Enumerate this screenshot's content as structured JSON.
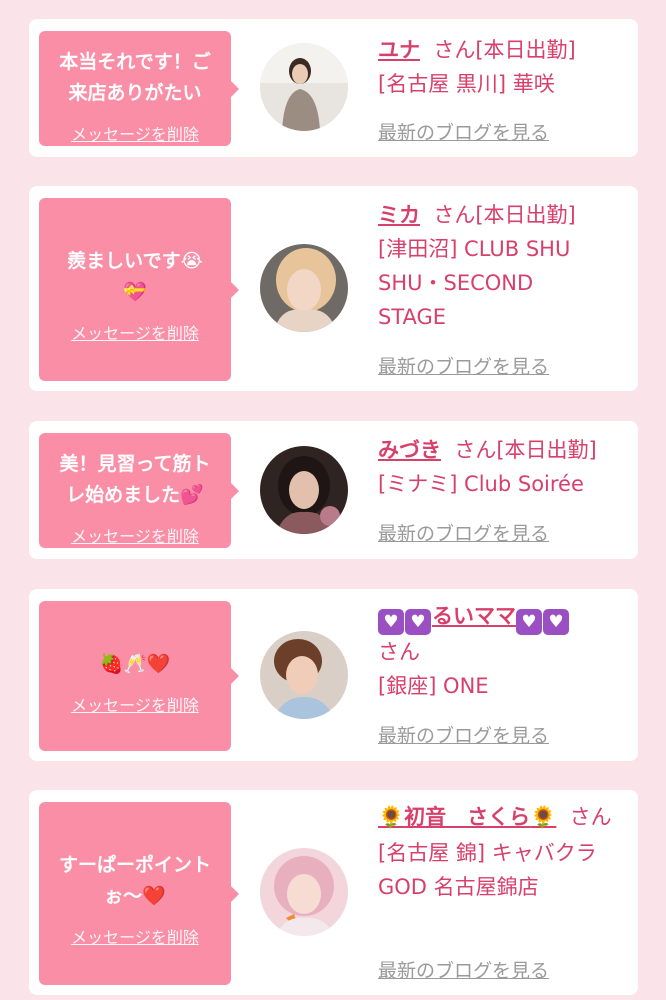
{
  "cards": [
    {
      "message": "本当それです！ご\n来店ありがたい",
      "delete_label": "メッセージを削除",
      "name": "ユナ",
      "honorific": "さん",
      "status": "[本日出勤]",
      "shop": "[名古屋 黒川] 華咲",
      "blog_label": "最新のブログを見る"
    },
    {
      "message": "羨ましいです😭\n💝",
      "delete_label": "メッセージを削除",
      "name": "ミカ",
      "honorific": "さん",
      "status": "[本日出勤]",
      "shop": "[津田沼] CLUB SHU\nSHU・SECOND\nSTAGE",
      "blog_label": "最新のブログを見る"
    },
    {
      "message": "美！見習って筋ト\nレ始めました💕",
      "delete_label": "メッセージを削除",
      "name": "みづき",
      "honorific": "さん",
      "status": "[本日出勤]",
      "shop": "[ミナミ] Club Soirée",
      "blog_label": "最新のブログを見る"
    },
    {
      "message": "🍓🥂❤️",
      "delete_label": "メッセージを削除",
      "name": "るいママ",
      "honorific": "さん",
      "status": "",
      "shop": "[銀座] ONE",
      "blog_label": "最新のブログを見る"
    },
    {
      "message": "すーぱーポイント\nぉ〜❤️",
      "delete_label": "メッセージを削除",
      "name": "初音　さくら",
      "honorific": "さん",
      "status": "",
      "shop": "[名古屋 錦] キャバクラ\nGOD 名古屋錦店",
      "blog_label": "最新のブログを見る"
    }
  ],
  "colors": {
    "background": "#fbe3ea",
    "bubble": "#f98ea6",
    "accent": "#d8406c",
    "link_gray": "#9a9a9a",
    "heart_box": "#9a4fc2"
  },
  "icons": {
    "heart_box": "purple-heart-icon",
    "sunflower": "sunflower-icon"
  }
}
